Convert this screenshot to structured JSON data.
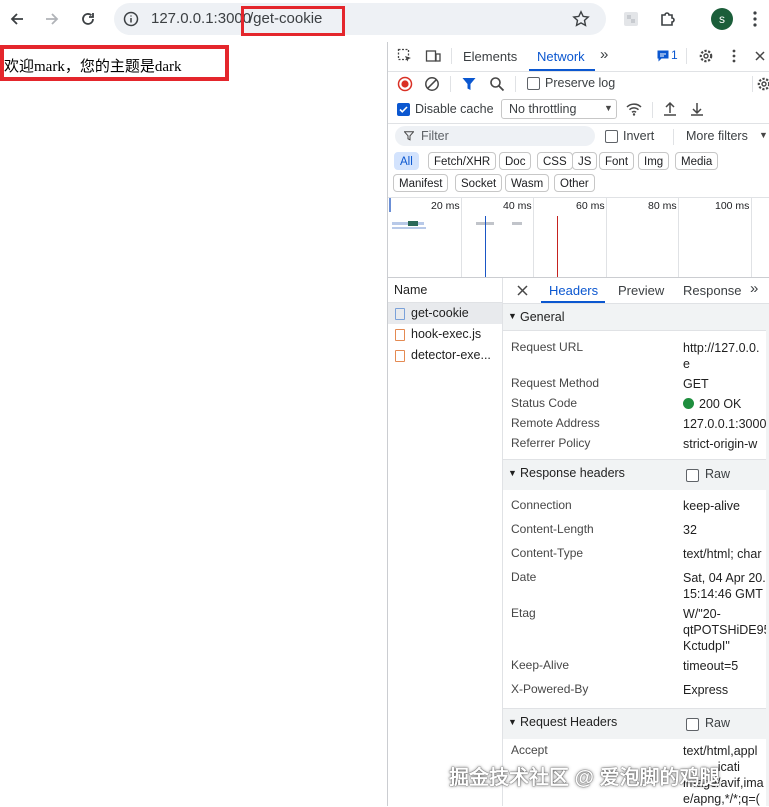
{
  "browser": {
    "url_host": "127.0.0.1:3000",
    "url_path": "/get-cookie",
    "profile_initial": "s"
  },
  "page": {
    "content": "欢迎mark，您的主题是dark"
  },
  "devtools": {
    "tabs": [
      "Elements",
      "Network"
    ],
    "issues_count": "1",
    "preserve_log": "Preserve log",
    "disable_cache": "Disable cache",
    "throttling": "No throttling",
    "filter_placeholder": "Filter",
    "invert": "Invert",
    "more_filters": "More filters",
    "type_chips": [
      "All",
      "Fetch/XHR",
      "Doc",
      "CSS",
      "JS",
      "Font",
      "Img",
      "Media"
    ],
    "type_chips_row2": [
      "Manifest",
      "Socket",
      "Wasm",
      "Other"
    ],
    "timeline_ticks": [
      "20 ms",
      "40 ms",
      "60 ms",
      "80 ms",
      "100 ms"
    ],
    "name_header": "Name",
    "requests": [
      {
        "name": "get-cookie",
        "type": "doc"
      },
      {
        "name": "hook-exec.js",
        "type": "js"
      },
      {
        "name": "detector-exe...",
        "type": "js"
      }
    ],
    "detail_tabs": [
      "Headers",
      "Preview",
      "Response"
    ],
    "general": {
      "title": "General",
      "rows": [
        {
          "key": "Request URL",
          "value": "http://127.0.0.\ne"
        },
        {
          "key": "Request Method",
          "value": "GET"
        },
        {
          "key": "Status Code",
          "value": "200 OK"
        },
        {
          "key": "Remote Address",
          "value": "127.0.0.1:3000"
        },
        {
          "key": "Referrer Policy",
          "value": "strict-origin-w"
        }
      ]
    },
    "response_headers": {
      "title": "Response headers",
      "raw": "Raw",
      "rows": [
        {
          "key": "Connection",
          "value": "keep-alive"
        },
        {
          "key": "Content-Length",
          "value": "32"
        },
        {
          "key": "Content-Type",
          "value": "text/html; char"
        },
        {
          "key": "Date",
          "value": "Sat, 04 Apr 20.\n15:14:46 GMT"
        },
        {
          "key": "Etag",
          "value": "W/\"20-\nqtPOTSHiDE95\nKctudpI\""
        },
        {
          "key": "Keep-Alive",
          "value": "timeout=5"
        },
        {
          "key": "X-Powered-By",
          "value": "Express"
        }
      ]
    },
    "request_headers": {
      "title": "Request Headers",
      "raw": "Raw",
      "rows": [
        {
          "key": "Accept",
          "value": "text/html,appl\n          icati\nimage/avif,ima\ne/apng,*/*;q=("
        }
      ]
    }
  },
  "watermark": "掘金技术社区 @ 爱泡脚的鸡腿",
  "colors": {
    "highlight": "#e4262c",
    "accent": "#0b57d0",
    "status_ok": "#1e8e3e"
  }
}
